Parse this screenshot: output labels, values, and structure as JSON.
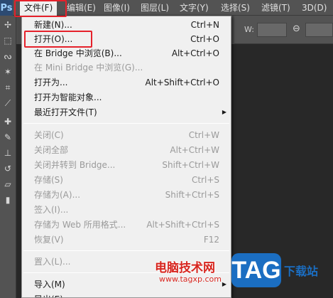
{
  "app": {
    "logo": "Ps"
  },
  "menubar": {
    "items": [
      "文件(F)",
      "编辑(E)",
      "图像(I)",
      "图层(L)",
      "文字(Y)",
      "选择(S)",
      "滤镜(T)",
      "3D(D)"
    ]
  },
  "options": {
    "w_label": "W:"
  },
  "file_menu": {
    "items": [
      {
        "label": "新建(N)...",
        "shortcut": "Ctrl+N",
        "enabled": true
      },
      {
        "label": "打开(O)...",
        "shortcut": "Ctrl+O",
        "enabled": true,
        "highlighted": true
      },
      {
        "label": "在 Bridge 中浏览(B)...",
        "shortcut": "Alt+Ctrl+O",
        "enabled": true
      },
      {
        "label": "在 Mini Bridge 中浏览(G)...",
        "shortcut": "",
        "enabled": false
      },
      {
        "label": "打开为...",
        "shortcut": "Alt+Shift+Ctrl+O",
        "enabled": true
      },
      {
        "label": "打开为智能对象...",
        "shortcut": "",
        "enabled": true
      },
      {
        "label": "最近打开文件(T)",
        "shortcut": "",
        "enabled": true,
        "submenu": true
      },
      {
        "label": "关闭(C)",
        "shortcut": "Ctrl+W",
        "enabled": false
      },
      {
        "label": "关闭全部",
        "shortcut": "Alt+Ctrl+W",
        "enabled": false
      },
      {
        "label": "关闭并转到 Bridge...",
        "shortcut": "Shift+Ctrl+W",
        "enabled": false
      },
      {
        "label": "存储(S)",
        "shortcut": "Ctrl+S",
        "enabled": false
      },
      {
        "label": "存储为(A)...",
        "shortcut": "Shift+Ctrl+S",
        "enabled": false
      },
      {
        "label": "签入(I)...",
        "shortcut": "",
        "enabled": false
      },
      {
        "label": "存储为 Web 所用格式...",
        "shortcut": "Alt+Shift+Ctrl+S",
        "enabled": false
      },
      {
        "label": "恢复(V)",
        "shortcut": "F12",
        "enabled": false
      },
      {
        "label": "置入(L)...",
        "shortcut": "",
        "enabled": false
      },
      {
        "label": "导入(M)",
        "shortcut": "",
        "enabled": true,
        "submenu": true
      },
      {
        "label": "导出(E)",
        "shortcut": "",
        "enabled": true,
        "submenu": true
      }
    ]
  },
  "watermark": {
    "title": "电脑技术网",
    "url": "www.tagxp.com",
    "badge": "TAG",
    "suffix": "下载站"
  },
  "colors": {
    "highlight_border": "#e5212b",
    "menu_bg": "#f0f0f0",
    "disabled_text": "#9a9a9a",
    "ui_dark": "#535353",
    "canvas": "#282828"
  },
  "icons": [
    "move-icon",
    "marquee-icon",
    "lasso-icon",
    "magic-wand-icon",
    "crop-icon",
    "eyedropper-icon",
    "healing-brush-icon",
    "brush-icon",
    "clone-stamp-icon",
    "history-brush-icon",
    "eraser-icon",
    "gradient-icon",
    "link-icon",
    "submenu-arrow-icon"
  ]
}
